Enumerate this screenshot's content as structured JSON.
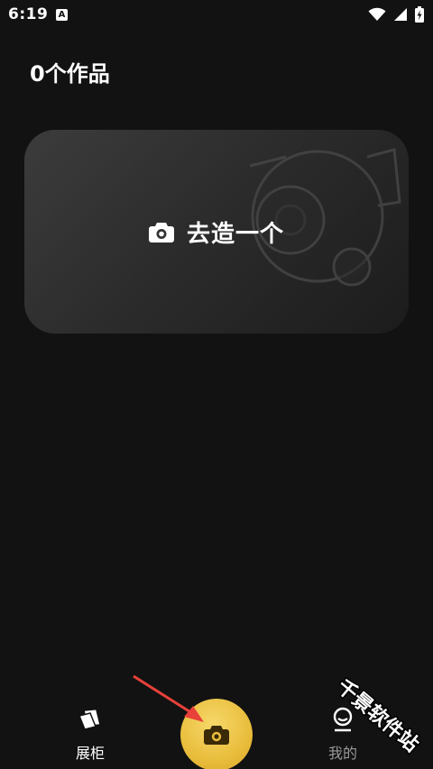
{
  "status_bar": {
    "time": "6:19",
    "app_icon_glyph": "A",
    "icons": [
      "wifi-icon",
      "signal-icon",
      "battery-icon"
    ]
  },
  "header": {
    "title": "0个作品"
  },
  "create_card": {
    "cta_label": "去造一个",
    "icon": "camera-icon"
  },
  "bottom_nav": {
    "items": [
      {
        "label": "展柜",
        "icon": "gallery-icon",
        "active": true
      },
      {
        "label": "我的",
        "icon": "profile-icon",
        "active": false
      }
    ],
    "fab_icon": "camera-icon",
    "fab_color": "#e9bd3c"
  },
  "watermark": {
    "text": "千景软件站"
  },
  "colors": {
    "background": "#121212",
    "accent": "#e9bd3c",
    "annotation": "#e8413a"
  }
}
